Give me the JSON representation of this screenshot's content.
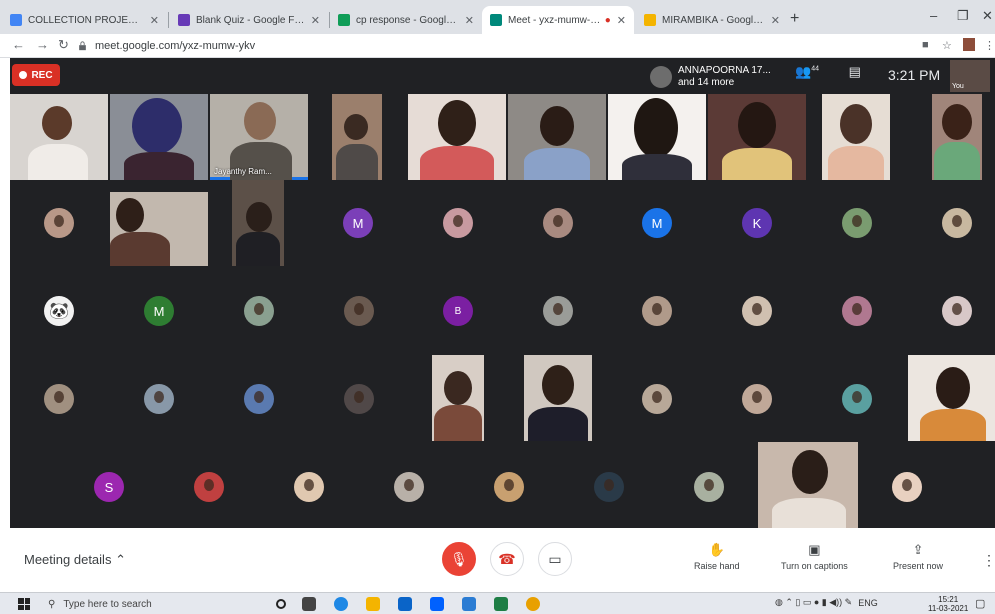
{
  "browser": {
    "tabs": [
      {
        "title": "COLLECTION PROJECT - Google",
        "favicon_color": "#4285f4",
        "active": false
      },
      {
        "title": "Blank Quiz - Google Forms",
        "favicon_color": "#673ab7",
        "active": false
      },
      {
        "title": "cp response - Google Sheets",
        "favicon_color": "#0f9d58",
        "active": false
      },
      {
        "title": "Meet - yxz-mumw-ykv",
        "favicon_color": "#00897b",
        "active": true
      },
      {
        "title": "MIRAMBIKA - Google Slides",
        "favicon_color": "#f4b400",
        "active": false
      }
    ],
    "new_tab": "+",
    "url": "meet.google.com/yxz-mumw-ykv"
  },
  "meet": {
    "rec_label": "REC",
    "presenter_name": "ANNAPOORNA 17...",
    "presenter_more": "and 14 more",
    "participants_count": "44",
    "time": "3:21 PM",
    "self_label": "You",
    "speaker_name": "Jayanthy Ram...",
    "initials": {
      "m1": "M",
      "m2": "M",
      "k": "K",
      "m3": "M",
      "b": "B",
      "s": "S"
    }
  },
  "controls": {
    "meeting_details": "Meeting details",
    "raise_hand": "Raise hand",
    "captions": "Turn on captions",
    "present": "Present now"
  },
  "taskbar": {
    "search_placeholder": "Type here to search",
    "lang": "ENG",
    "time": "15:21",
    "date": "11-03-2021"
  },
  "colors": {
    "meet_bg": "#202124",
    "accent_red": "#ea4335",
    "avatar_purple": "#7b3fb8",
    "avatar_green": "#2e7d32",
    "avatar_blue": "#1a73e8",
    "avatar_violet": "#5e35b1"
  }
}
